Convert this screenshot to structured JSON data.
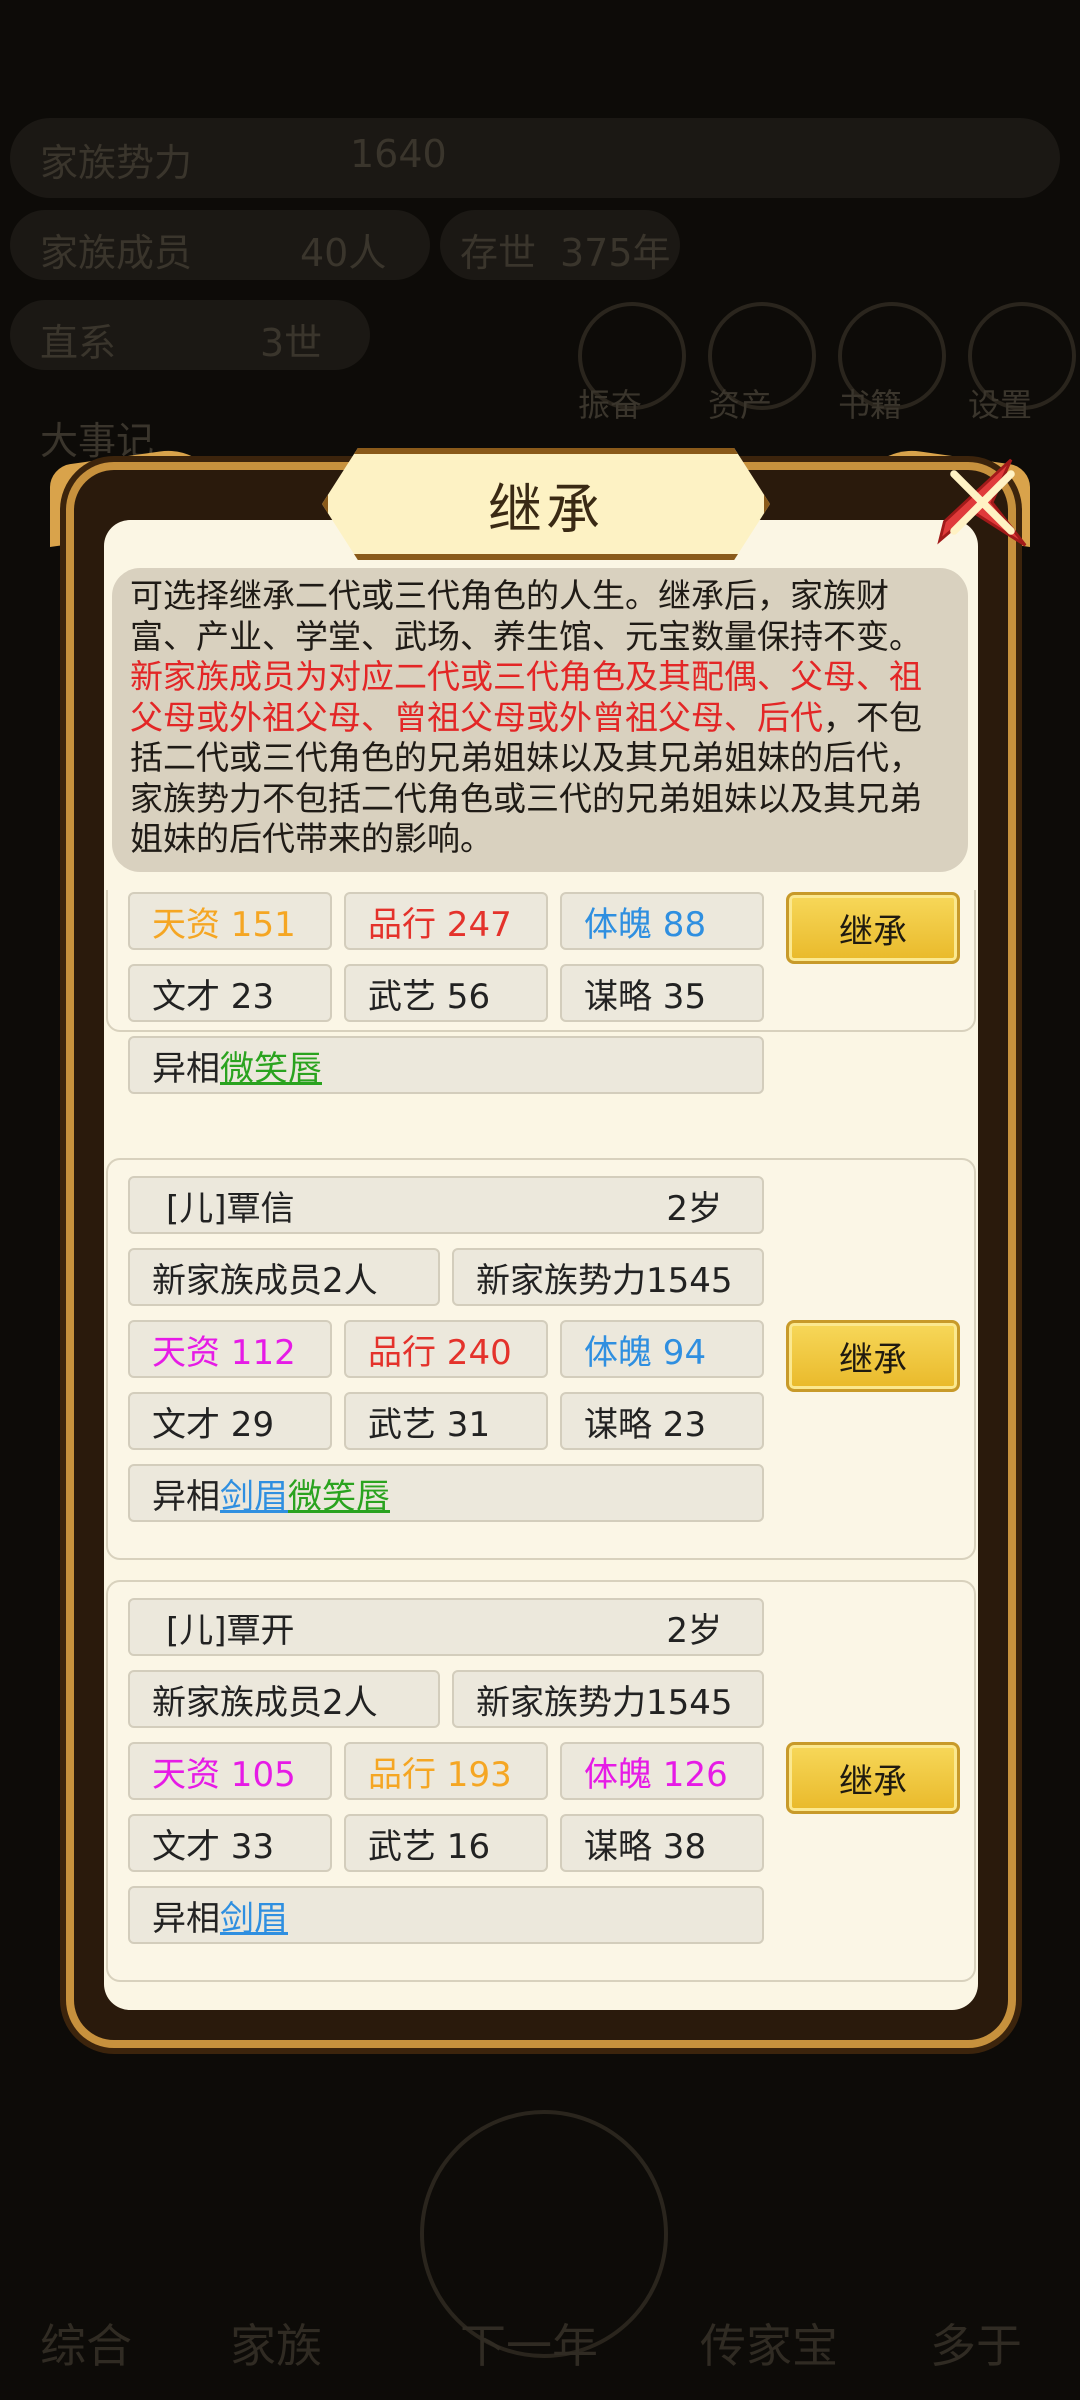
{
  "background": {
    "faded_labels": [
      "家族势力",
      "1640",
      "家族成员",
      "40人",
      "存世",
      "375年",
      "直系",
      "3世",
      "振奋",
      "资产",
      "书籍",
      "设置",
      "大事记"
    ],
    "nav_items": [
      "综合",
      "家族",
      "下一年",
      "传家宝",
      "多于"
    ]
  },
  "dialog": {
    "title": "继承",
    "description_plain_1": "可选择继承二代或三代角色的人生。继承后，家族财富、产业、学堂、武场、养生馆、元宝数量保持不变。",
    "description_red": "新家族成员为对应二代或三代角色及其配偶、父母、祖父母或外祖父母、曾祖父母或外曾祖父母、后代",
    "description_plain_2": "，不包括二代或三代角色的兄弟姐妹以及其兄弟姐妹的后代，家族势力不包括二代角色或三代的兄弟姐妹以及其兄弟姐妹的后代带来的影响。",
    "inherit_label": "继承",
    "cards": [
      {
        "talent": "天资 151",
        "talent_color": "#f5a623",
        "virtue": "品行 247",
        "virtue_color": "#e4322b",
        "physique": "体魄 88",
        "physique_color": "#2f8fe0",
        "literacy": "文才 23",
        "martial": "武艺 56",
        "strategy": "谋略 35",
        "features_label": "异相",
        "traits": [
          "微笑唇"
        ]
      },
      {
        "name": "[儿]覃信",
        "age": "2岁",
        "members": "新家族成员2人",
        "power": "新家族势力1545",
        "talent": "天资 112",
        "talent_color": "#e61be6",
        "virtue": "品行 240",
        "virtue_color": "#e4322b",
        "physique": "体魄 94",
        "physique_color": "#2f8fe0",
        "literacy": "文才 29",
        "martial": "武艺 31",
        "strategy": "谋略 23",
        "features_label": "异相",
        "traits": [
          "剑眉",
          "微笑唇"
        ]
      },
      {
        "name": "[儿]覃开",
        "age": "2岁",
        "members": "新家族成员2人",
        "power": "新家族势力1545",
        "talent": "天资 105",
        "talent_color": "#e61be6",
        "virtue": "品行 193",
        "virtue_color": "#f5a623",
        "physique": "体魄 126",
        "physique_color": "#e61be6",
        "literacy": "文才 33",
        "martial": "武艺 16",
        "strategy": "谋略 38",
        "features_label": "异相",
        "traits": [
          "剑眉"
        ]
      }
    ]
  }
}
